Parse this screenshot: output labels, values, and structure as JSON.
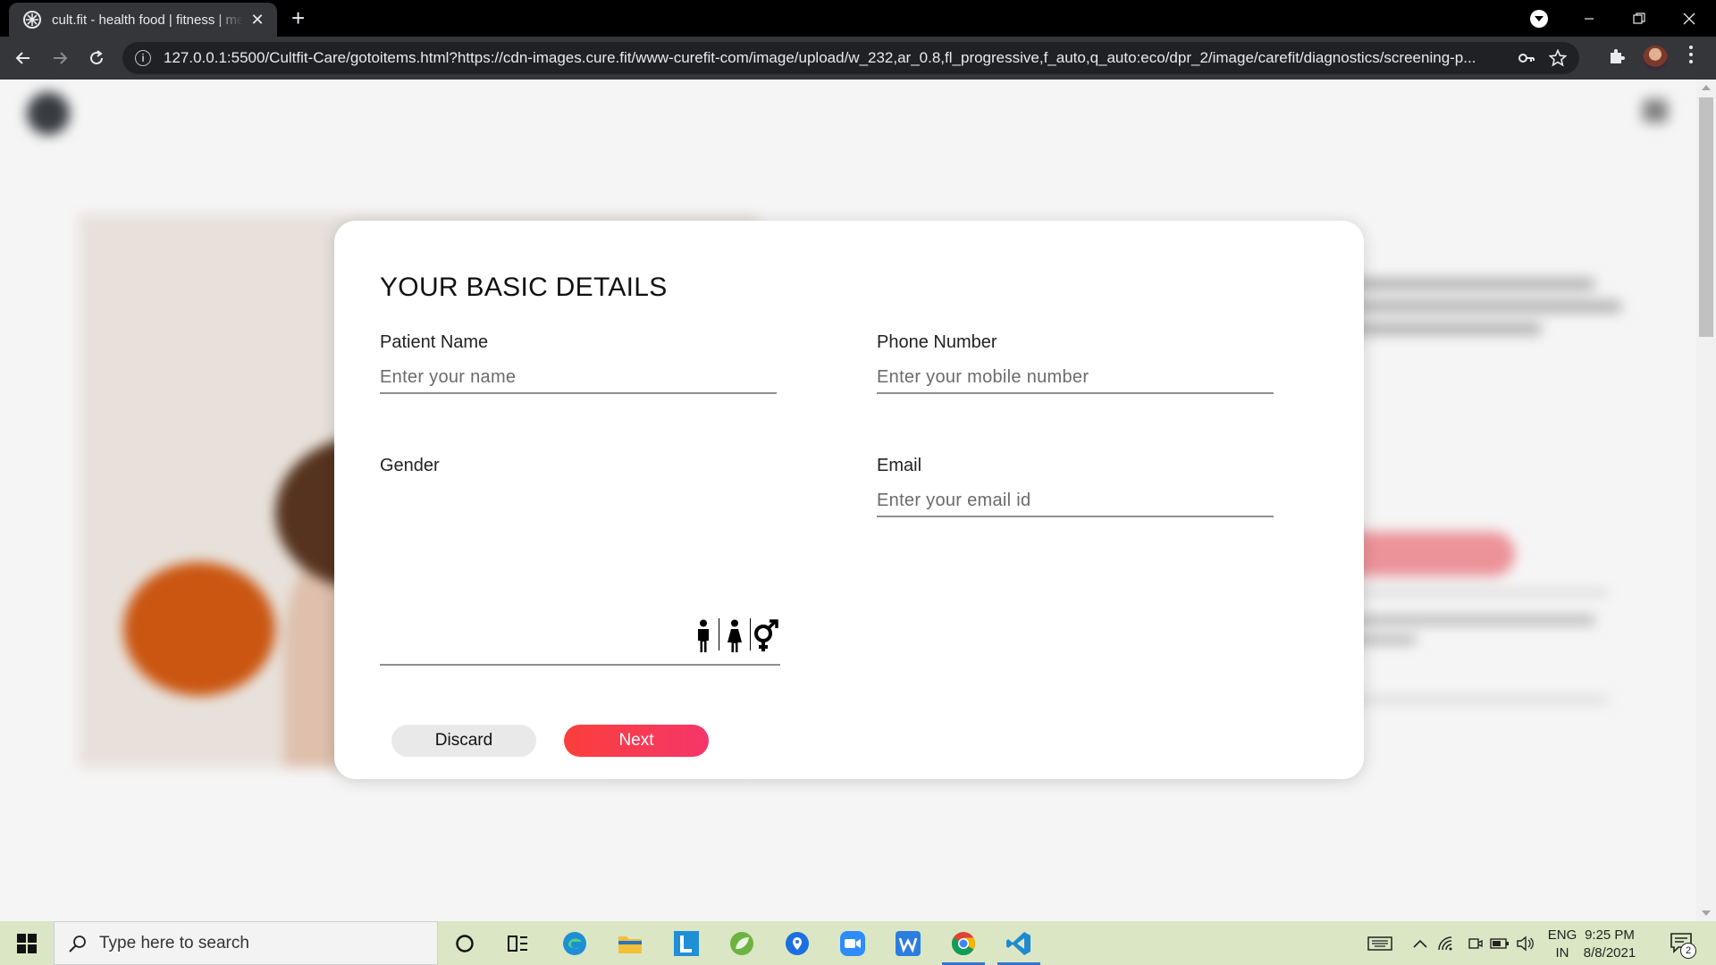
{
  "browser": {
    "tab_title": "cult.fit - health food | fitness | meditation",
    "tab_close": "✕",
    "new_tab": "+",
    "url": "127.0.0.1:5500/Cultfit-Care/gotoitems.html?https://cdn-images.cure.fit/www-curefit-com/image/upload/w_232,ar_0.8,fl_progressive,f_auto,q_auto:eco/dpr_2/image/carefit/diagnostics/screening-p..."
  },
  "modal": {
    "title": "YOUR BASIC DETAILS",
    "patient_name": {
      "label": "Patient Name",
      "placeholder": "Enter your name",
      "value": ""
    },
    "phone": {
      "label": "Phone Number",
      "placeholder": "Enter your mobile number",
      "value": ""
    },
    "gender": {
      "label": "Gender",
      "options": [
        "male-icon",
        "female-icon",
        "other-gender-icon"
      ]
    },
    "email": {
      "label": "Email",
      "placeholder": "Enter your email id",
      "value": ""
    },
    "discard_label": "Discard",
    "next_label": "Next",
    "next_color": "#fb3f3c"
  },
  "taskbar": {
    "search_placeholder": "Type here to search",
    "lang_top": "ENG",
    "lang_bottom": "IN",
    "time": "9:25 PM",
    "date": "8/8/2021",
    "notification_count": "2"
  }
}
